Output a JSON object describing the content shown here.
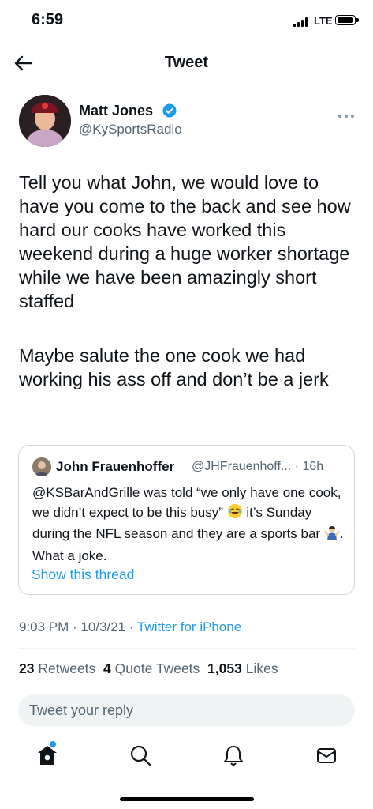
{
  "status_bar": {
    "time": "6:59",
    "network": "LTE"
  },
  "header": {
    "title": "Tweet"
  },
  "tweet": {
    "author_name": "Matt Jones",
    "author_handle": "@KySportsRadio",
    "paragraphs": [
      "Tell you what John, we would love to have you come to the back and see how hard our cooks have worked this weekend during a huge worker shortage while we have been amazingly short staffed",
      "Maybe salute the one cook we had working his ass off and don’t be a jerk"
    ]
  },
  "quoted_tweet": {
    "author_name": "John Frauenhoffer",
    "author_handle": "@JHFrauenhoff...",
    "time": "· 16h",
    "body_part1": "@KSBarAndGrille was told “we only have one cook, we didn’t expect to be this busy”",
    "body_part2": "it’s Sunday during the NFL season and they are a sports bar",
    "body_part3": ". What a joke.",
    "show_thread": "Show this thread"
  },
  "meta": {
    "time": "9:03 PM",
    "date": "10/3/21",
    "source": "Twitter for iPhone"
  },
  "stats": {
    "retweets_count": "23",
    "retweets_label": "Retweets",
    "quotes_count": "4",
    "quotes_label": "Quote Tweets",
    "likes_count": "1,053",
    "likes_label": "Likes"
  },
  "reply": {
    "placeholder": "Tweet your reply"
  },
  "icons": {
    "back": "arrow-left-icon",
    "verified": "verified-badge-icon",
    "more": "more-horizontal-icon",
    "tabs": [
      "home-icon",
      "search-icon",
      "notifications-icon",
      "messages-icon"
    ]
  },
  "colors": {
    "accent": "#1d9bf0",
    "secondary_text": "#536471",
    "text": "#0f1419"
  }
}
